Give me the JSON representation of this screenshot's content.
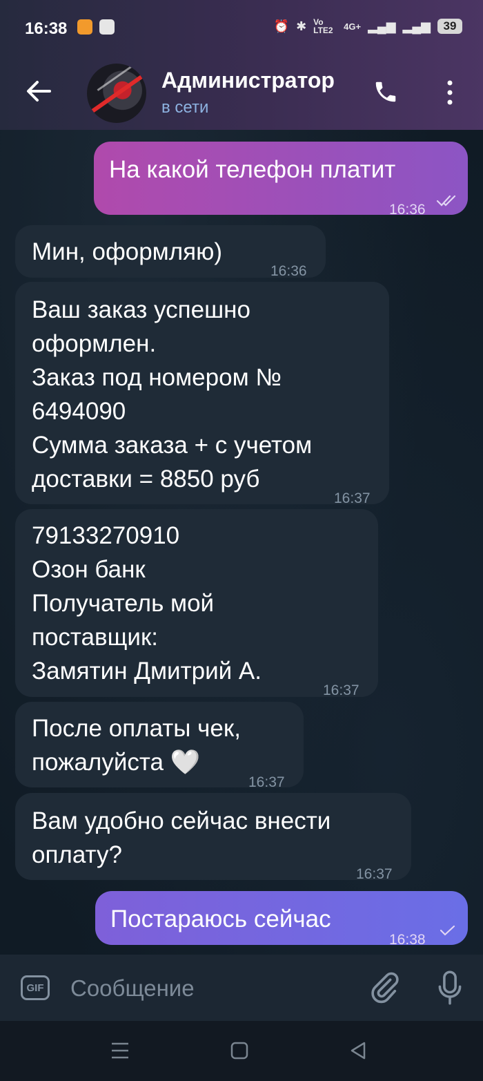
{
  "status_bar": {
    "time": "16:38",
    "battery": "39",
    "network": "4G+",
    "lte": "Vo LTE2"
  },
  "header": {
    "contact_name": "Администратор",
    "contact_status": "в сети"
  },
  "messages": [
    {
      "direction": "out",
      "text": "На какой телефон платит",
      "time": "16:36",
      "status": "read"
    },
    {
      "direction": "in",
      "text": "Мин, оформляю)",
      "time": "16:36"
    },
    {
      "direction": "in",
      "text": "Ваш заказ успешно\nоформлен.\nЗаказ под номером №\n6494090\nСумма заказа + с учетом\nдоставки = 8850  руб",
      "time": "16:37"
    },
    {
      "direction": "in",
      "text": "79133270910\nОзон банк\nПолучатель мой\nпоставщик:\nЗамятин Дмитрий А.",
      "time": "16:37"
    },
    {
      "direction": "in",
      "text": "После оплаты чек,\nпожалуйста 🤍",
      "time": "16:37"
    },
    {
      "direction": "in",
      "text": "Вам удобно сейчас внести\nоплату?",
      "time": "16:37"
    },
    {
      "direction": "out",
      "text": "Постараюсь сейчас",
      "time": "16:38",
      "status": "sent"
    }
  ],
  "composer": {
    "gif_label": "GIF",
    "placeholder": "Сообщение"
  },
  "colors": {
    "incoming": "#1f2b37",
    "outgoing_start": "#b04aac",
    "outgoing_end": "#6a6ee6",
    "online": "#8db2e0"
  }
}
